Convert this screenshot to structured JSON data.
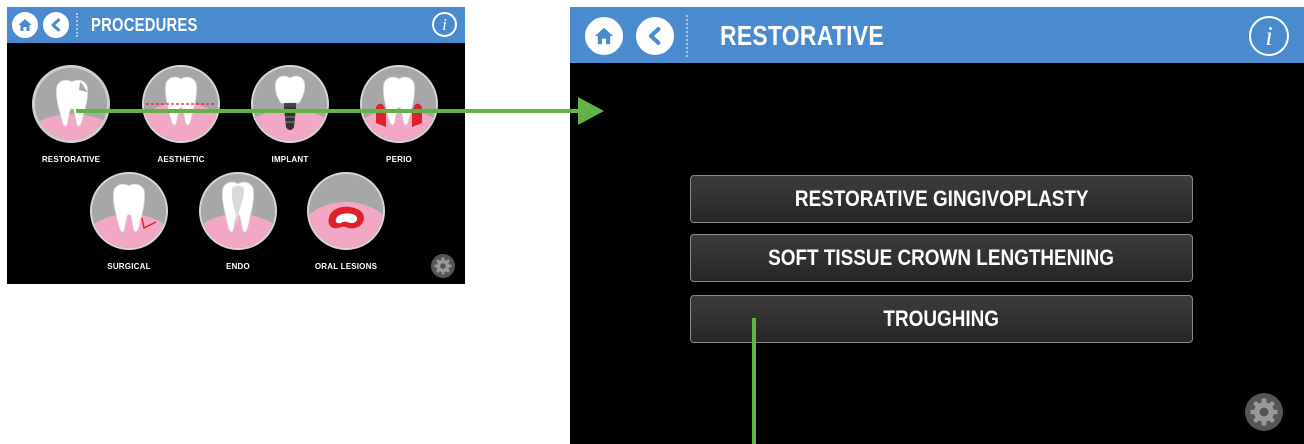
{
  "left_screen": {
    "title": "PROCEDURES",
    "info_label": "i",
    "procedures": [
      {
        "label": "RESTORATIVE",
        "icon": "restorative-tooth-icon"
      },
      {
        "label": "AESTHETIC",
        "icon": "aesthetic-tooth-icon"
      },
      {
        "label": "IMPLANT",
        "icon": "implant-tooth-icon"
      },
      {
        "label": "PERIO",
        "icon": "perio-tooth-icon"
      },
      {
        "label": "SURGICAL",
        "icon": "surgical-tooth-icon"
      },
      {
        "label": "ENDO",
        "icon": "endo-tooth-icon"
      },
      {
        "label": "ORAL LESIONS",
        "icon": "oral-lesion-icon"
      }
    ],
    "icons": [
      "home-icon",
      "back-icon",
      "info-icon",
      "gear-icon"
    ]
  },
  "right_screen": {
    "title": "RESTORATIVE",
    "info_label": "i",
    "menu": [
      {
        "label": "RESTORATIVE GINGIVOPLASTY"
      },
      {
        "label": "SOFT TISSUE CROWN LENGTHENING"
      },
      {
        "label": "TROUGHING"
      }
    ],
    "icons": [
      "home-icon",
      "back-icon",
      "info-icon",
      "gear-icon"
    ]
  },
  "colors": {
    "title_bar": "#4a8bd0",
    "screen_bg": "#000000",
    "gum_pink": "#f2a7c4",
    "arrow_green": "#5fb347",
    "accent_red": "#e0202a"
  }
}
